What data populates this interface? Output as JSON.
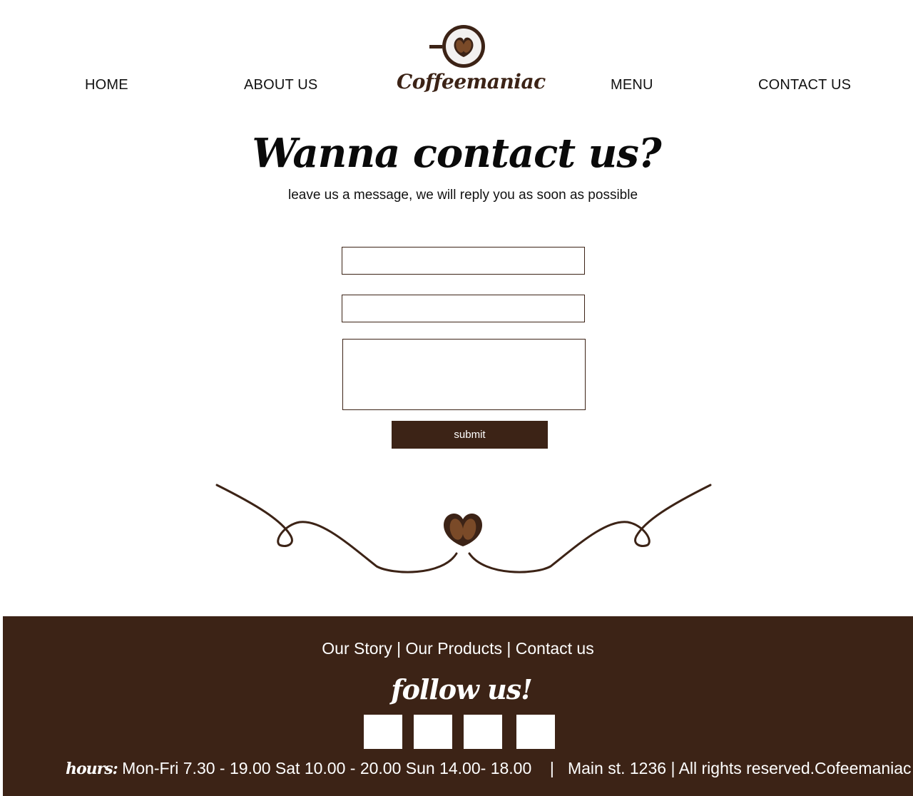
{
  "nav": {
    "home": "HOME",
    "about": "ABOUT US",
    "menu": "MENU",
    "contact": "CONTACT US"
  },
  "brand": {
    "name": "Coffeemaniac",
    "color": "#3c2316",
    "bean_color": "#7a4a28"
  },
  "hero": {
    "title": "Wanna contact us?",
    "subtitle": "leave us a message, we will reply you as soon as possible"
  },
  "form": {
    "field_1_value": "",
    "field_2_value": "",
    "message_value": "",
    "submit_label": "submit"
  },
  "footer": {
    "links": [
      "Our Story",
      "Our Products",
      "Contact us"
    ],
    "separator": "|",
    "follow_title": "follow us!",
    "social_icons": [
      "social-link-1",
      "social-link-2",
      "social-link-3",
      "social-link-4"
    ],
    "hours_label": "hours:",
    "hours_text": "Mon-Fri 7.30 - 19.00 Sat  10.00 - 20.00 Sun  14.00- 18.00",
    "divider": "|",
    "address": "Main st. 1236",
    "rights": "All rights reserved.Cofeemaniac"
  }
}
